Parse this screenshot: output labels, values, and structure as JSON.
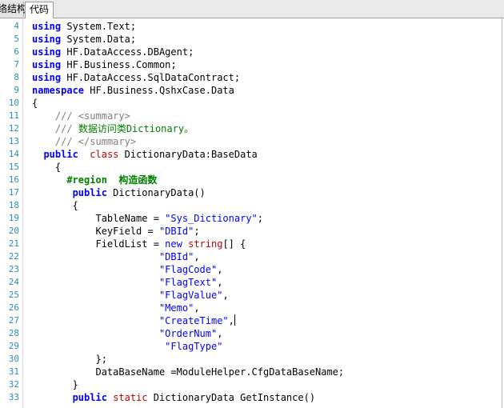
{
  "tabs": [
    {
      "label": "络结构",
      "active": false
    },
    {
      "label": "代码",
      "active": true
    }
  ],
  "colors": {
    "keyword": "#0000ff",
    "string": "#0000ff",
    "type_red": "#c00000",
    "comment": "#008000",
    "line_number": "#2b91af"
  },
  "code": {
    "lines": [
      {
        "num": "4",
        "tokens": [
          {
            "t": "using",
            "c": "kw"
          },
          {
            "t": " System.Text;",
            "c": "tx"
          }
        ]
      },
      {
        "num": "5",
        "tokens": [
          {
            "t": "using",
            "c": "kw"
          },
          {
            "t": " System.Data;",
            "c": "tx"
          }
        ]
      },
      {
        "num": "6",
        "tokens": [
          {
            "t": "using",
            "c": "kw"
          },
          {
            "t": " HF.DataAccess.DBAgent;",
            "c": "tx"
          }
        ]
      },
      {
        "num": "7",
        "tokens": [
          {
            "t": "using",
            "c": "kw"
          },
          {
            "t": " HF.Business.Common;",
            "c": "tx"
          }
        ]
      },
      {
        "num": "8",
        "tokens": [
          {
            "t": "using",
            "c": "kw"
          },
          {
            "t": " HF.DataAccess.SqlDataContract;",
            "c": "tx"
          }
        ]
      },
      {
        "num": "9",
        "tokens": [
          {
            "t": "namespace",
            "c": "kw"
          },
          {
            "t": " HF.Business.QshxCase.Data",
            "c": "tx"
          }
        ]
      },
      {
        "num": "10",
        "tokens": [
          {
            "t": "{",
            "c": "tx"
          }
        ]
      },
      {
        "num": "11",
        "tokens": [
          {
            "t": "    ",
            "c": "tx"
          },
          {
            "t": "///",
            "c": "cmtg"
          },
          {
            "t": " <summary>",
            "c": "cmtg"
          }
        ]
      },
      {
        "num": "12",
        "tokens": [
          {
            "t": "    ",
            "c": "tx"
          },
          {
            "t": "///",
            "c": "cmtg"
          },
          {
            "t": " 数据访问类Dictionary。",
            "c": "cmt"
          }
        ]
      },
      {
        "num": "13",
        "tokens": [
          {
            "t": "    ",
            "c": "tx"
          },
          {
            "t": "///",
            "c": "cmtg"
          },
          {
            "t": " </summary>",
            "c": "cmtg"
          }
        ]
      },
      {
        "num": "14",
        "tokens": [
          {
            "t": "  ",
            "c": "tx"
          },
          {
            "t": "public",
            "c": "kw"
          },
          {
            "t": "  ",
            "c": "tx"
          },
          {
            "t": "class",
            "c": "red"
          },
          {
            "t": " DictionaryData:BaseData",
            "c": "tx"
          }
        ]
      },
      {
        "num": "15",
        "tokens": [
          {
            "t": "    {",
            "c": "tx"
          }
        ]
      },
      {
        "num": "16",
        "tokens": [
          {
            "t": "      ",
            "c": "tx"
          },
          {
            "t": "#region  构造函数",
            "c": "reg"
          }
        ]
      },
      {
        "num": "17",
        "tokens": [
          {
            "t": "       ",
            "c": "tx"
          },
          {
            "t": "public",
            "c": "kw"
          },
          {
            "t": " DictionaryData()",
            "c": "tx"
          }
        ]
      },
      {
        "num": "18",
        "tokens": [
          {
            "t": "       {",
            "c": "tx"
          }
        ]
      },
      {
        "num": "19",
        "tokens": [
          {
            "t": "           TableName = ",
            "c": "tx"
          },
          {
            "t": "\"Sys_Dictionary\"",
            "c": "str"
          },
          {
            "t": ";",
            "c": "tx"
          }
        ]
      },
      {
        "num": "20",
        "tokens": [
          {
            "t": "           KeyField = ",
            "c": "tx"
          },
          {
            "t": "\"DBId\"",
            "c": "str"
          },
          {
            "t": ";",
            "c": "tx"
          }
        ]
      },
      {
        "num": "21",
        "tokens": [
          {
            "t": "           FieldList = ",
            "c": "tx"
          },
          {
            "t": "new",
            "c": "kw2"
          },
          {
            "t": " ",
            "c": "tx"
          },
          {
            "t": "string",
            "c": "red"
          },
          {
            "t": "[] {",
            "c": "tx"
          }
        ]
      },
      {
        "num": "22",
        "tokens": [
          {
            "t": "                      ",
            "c": "tx"
          },
          {
            "t": "\"DBId\"",
            "c": "str"
          },
          {
            "t": ",",
            "c": "tx"
          }
        ]
      },
      {
        "num": "23",
        "tokens": [
          {
            "t": "                      ",
            "c": "tx"
          },
          {
            "t": "\"FlagCode\"",
            "c": "str"
          },
          {
            "t": ",",
            "c": "tx"
          }
        ]
      },
      {
        "num": "24",
        "tokens": [
          {
            "t": "                      ",
            "c": "tx"
          },
          {
            "t": "\"FlagText\"",
            "c": "str"
          },
          {
            "t": ",",
            "c": "tx"
          }
        ]
      },
      {
        "num": "25",
        "tokens": [
          {
            "t": "                      ",
            "c": "tx"
          },
          {
            "t": "\"FlagValue\"",
            "c": "str"
          },
          {
            "t": ",",
            "c": "tx"
          }
        ]
      },
      {
        "num": "26",
        "tokens": [
          {
            "t": "                      ",
            "c": "tx"
          },
          {
            "t": "\"Memo\"",
            "c": "str"
          },
          {
            "t": ",",
            "c": "tx"
          }
        ]
      },
      {
        "num": "27",
        "tokens": [
          {
            "t": "                      ",
            "c": "tx"
          },
          {
            "t": "\"CreateTime\"",
            "c": "str"
          },
          {
            "t": ",",
            "c": "tx"
          },
          {
            "t": "",
            "c": "cursor"
          }
        ]
      },
      {
        "num": "28",
        "tokens": [
          {
            "t": "                      ",
            "c": "tx"
          },
          {
            "t": "\"OrderNum\"",
            "c": "str"
          },
          {
            "t": ",",
            "c": "tx"
          }
        ]
      },
      {
        "num": "29",
        "tokens": [
          {
            "t": "                       ",
            "c": "tx"
          },
          {
            "t": "\"FlagType\"",
            "c": "str"
          }
        ]
      },
      {
        "num": "30",
        "tokens": [
          {
            "t": "           };",
            "c": "tx"
          }
        ]
      },
      {
        "num": "31",
        "tokens": [
          {
            "t": "           DataBaseName =ModuleHelper.CfgDataBaseName;",
            "c": "tx"
          }
        ]
      },
      {
        "num": "32",
        "tokens": [
          {
            "t": "       }",
            "c": "tx"
          }
        ]
      },
      {
        "num": "33",
        "tokens": [
          {
            "t": "       ",
            "c": "tx"
          },
          {
            "t": "public",
            "c": "kw"
          },
          {
            "t": " ",
            "c": "tx"
          },
          {
            "t": "static",
            "c": "red"
          },
          {
            "t": " DictionaryData ",
            "c": "tx"
          },
          {
            "t": "GetInstance()",
            "c": "tx"
          }
        ]
      }
    ]
  }
}
